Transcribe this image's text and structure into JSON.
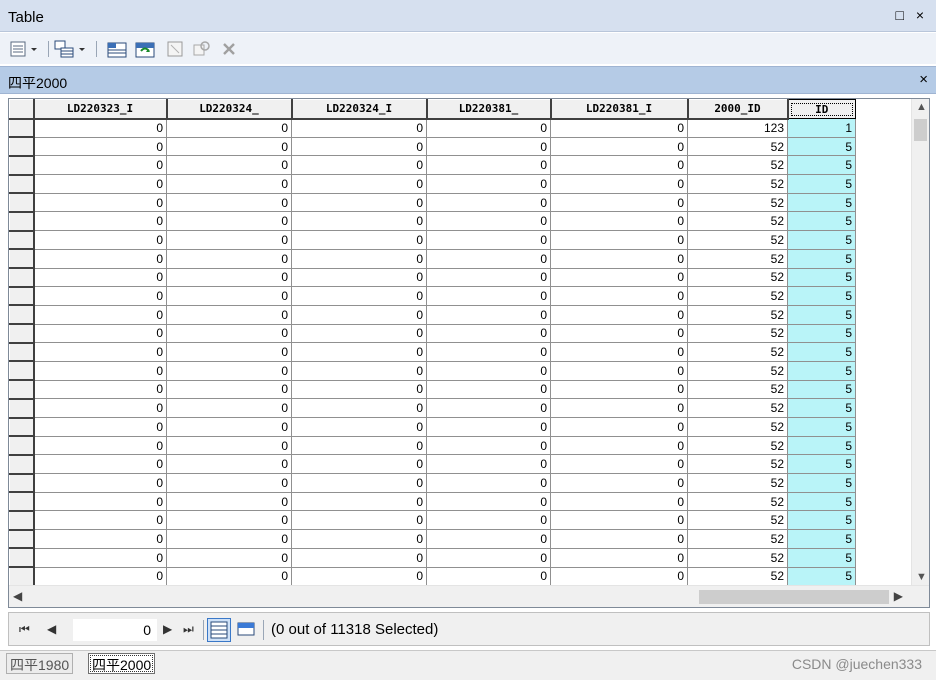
{
  "window": {
    "title": "Table",
    "controls": "□ ×"
  },
  "toolbar": {
    "icons": [
      "table-options-icon",
      "related-tables-icon",
      "select-by-attributes-icon",
      "switch-selection-icon",
      "clear-selection-icon",
      "zoom-to-selected-icon",
      "delete-selected-icon"
    ]
  },
  "table_tab": {
    "name": "四平2000",
    "close": "×"
  },
  "grid": {
    "columns": [
      "LD220323_I",
      "LD220324_",
      "LD220324_I",
      "LD220381_",
      "LD220381_I",
      "2000_ID",
      "ID"
    ],
    "active_column": "ID",
    "rows": [
      [
        "0",
        "0",
        "0",
        "0",
        "0",
        "123",
        "1"
      ],
      [
        "0",
        "0",
        "0",
        "0",
        "0",
        "52",
        "5"
      ],
      [
        "0",
        "0",
        "0",
        "0",
        "0",
        "52",
        "5"
      ],
      [
        "0",
        "0",
        "0",
        "0",
        "0",
        "52",
        "5"
      ],
      [
        "0",
        "0",
        "0",
        "0",
        "0",
        "52",
        "5"
      ],
      [
        "0",
        "0",
        "0",
        "0",
        "0",
        "52",
        "5"
      ],
      [
        "0",
        "0",
        "0",
        "0",
        "0",
        "52",
        "5"
      ],
      [
        "0",
        "0",
        "0",
        "0",
        "0",
        "52",
        "5"
      ],
      [
        "0",
        "0",
        "0",
        "0",
        "0",
        "52",
        "5"
      ],
      [
        "0",
        "0",
        "0",
        "0",
        "0",
        "52",
        "5"
      ],
      [
        "0",
        "0",
        "0",
        "0",
        "0",
        "52",
        "5"
      ],
      [
        "0",
        "0",
        "0",
        "0",
        "0",
        "52",
        "5"
      ],
      [
        "0",
        "0",
        "0",
        "0",
        "0",
        "52",
        "5"
      ],
      [
        "0",
        "0",
        "0",
        "0",
        "0",
        "52",
        "5"
      ],
      [
        "0",
        "0",
        "0",
        "0",
        "0",
        "52",
        "5"
      ],
      [
        "0",
        "0",
        "0",
        "0",
        "0",
        "52",
        "5"
      ],
      [
        "0",
        "0",
        "0",
        "0",
        "0",
        "52",
        "5"
      ],
      [
        "0",
        "0",
        "0",
        "0",
        "0",
        "52",
        "5"
      ],
      [
        "0",
        "0",
        "0",
        "0",
        "0",
        "52",
        "5"
      ],
      [
        "0",
        "0",
        "0",
        "0",
        "0",
        "52",
        "5"
      ],
      [
        "0",
        "0",
        "0",
        "0",
        "0",
        "52",
        "5"
      ],
      [
        "0",
        "0",
        "0",
        "0",
        "0",
        "52",
        "5"
      ],
      [
        "0",
        "0",
        "0",
        "0",
        "0",
        "52",
        "5"
      ],
      [
        "0",
        "0",
        "0",
        "0",
        "0",
        "52",
        "5"
      ],
      [
        "0",
        "0",
        "0",
        "0",
        "0",
        "52",
        "5"
      ]
    ]
  },
  "navigation": {
    "current_record": "0",
    "selection_status": "(0 out of 11318 Selected)"
  },
  "bottom_tabs": [
    "四平1980",
    "四平2000"
  ],
  "active_bottom_tab": "四平2000",
  "watermark": "CSDN @juechen333",
  "colors": {
    "title_bar": "#d6e0ef",
    "tab_bar": "#b5cbe6",
    "id_column_highlight": "#b9f4f8"
  }
}
